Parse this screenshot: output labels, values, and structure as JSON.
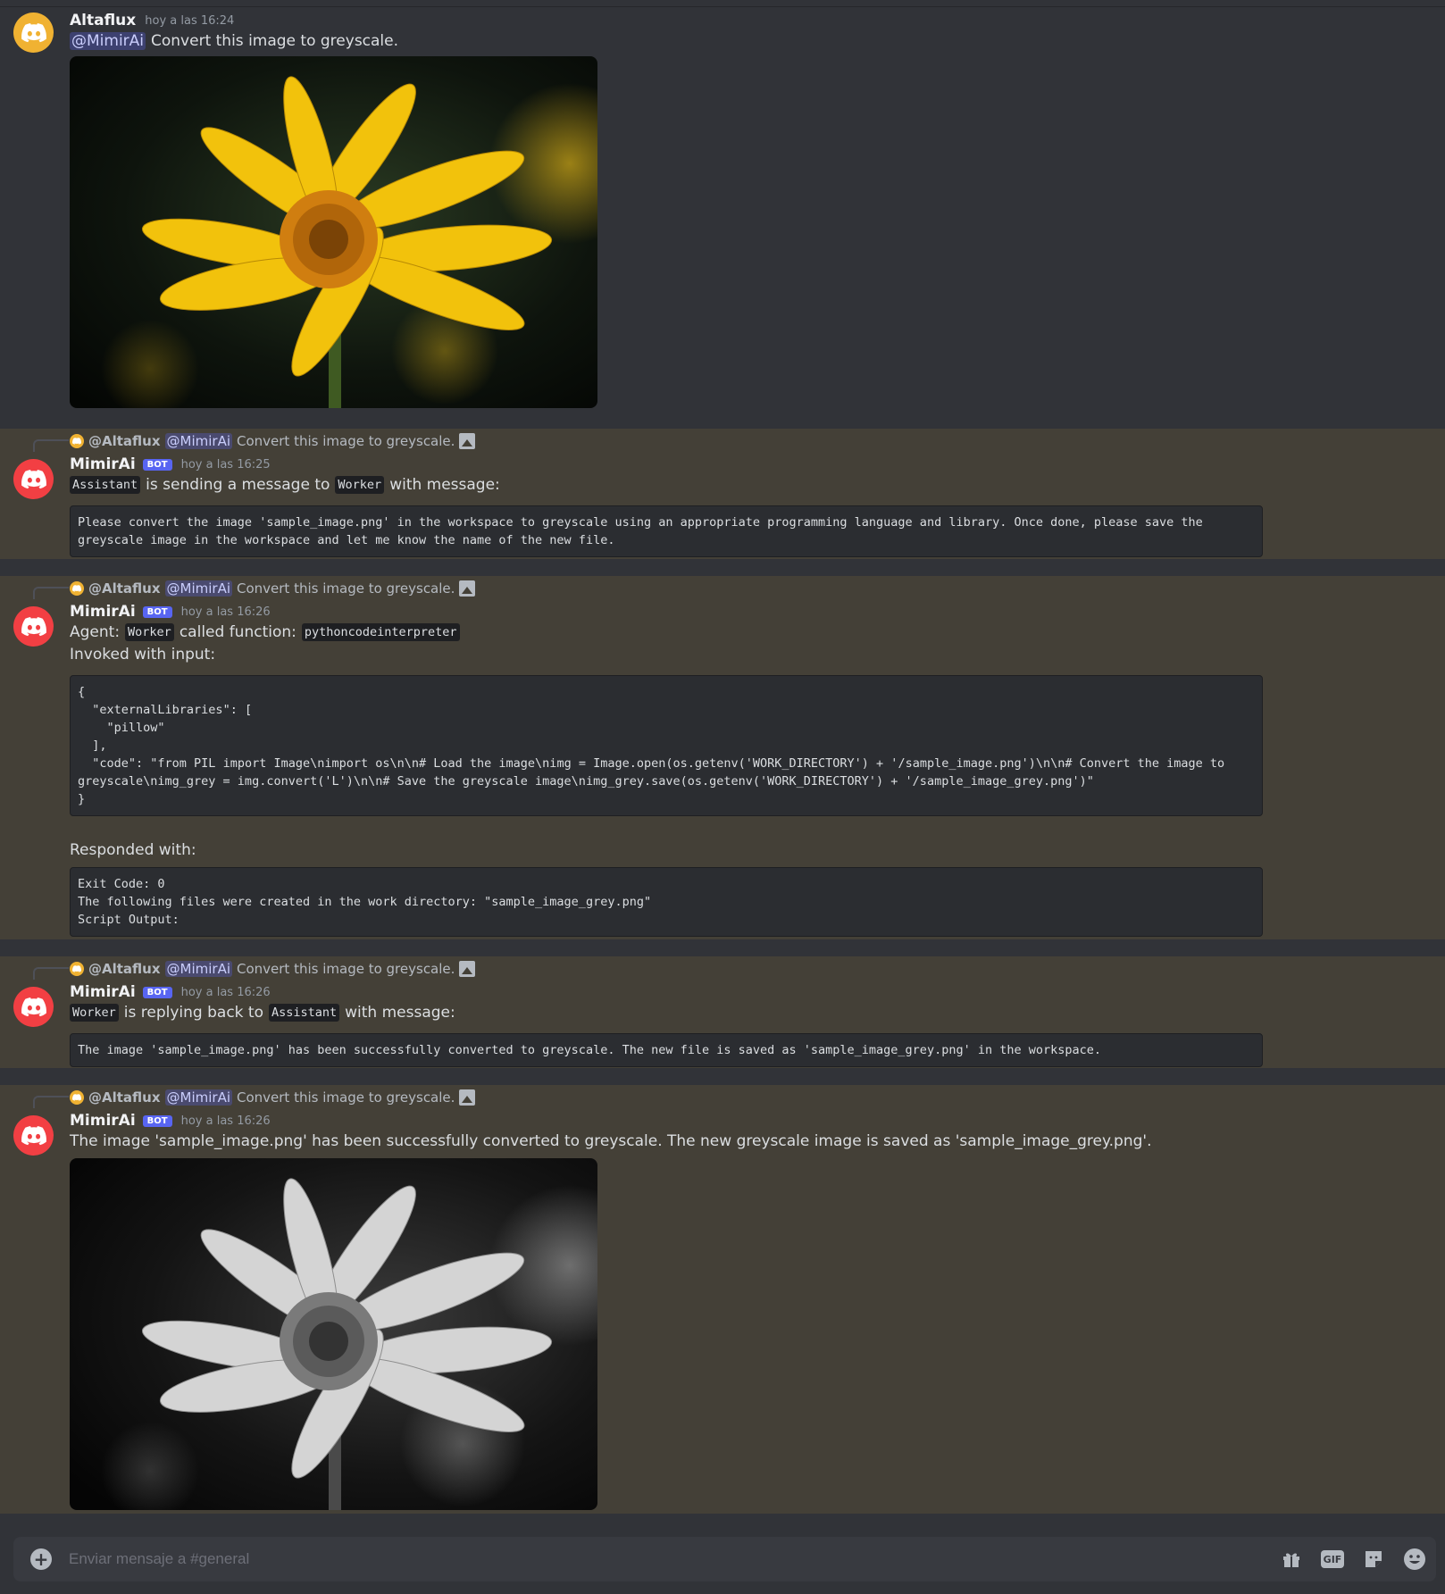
{
  "messages": {
    "m1": {
      "author": "Altaflux",
      "timestamp": "hoy a las 16:24",
      "mention": "@MimirAi",
      "text": "Convert this image to greyscale."
    },
    "reply": {
      "author": "@Altaflux",
      "mention": "@MimirAi",
      "text": "Convert this image to greyscale."
    },
    "m2": {
      "author": "MimirAi",
      "badge": "BOT",
      "timestamp": "hoy a las 16:25",
      "code_from": "Assistant",
      "mid": "is sending a message to",
      "code_to": "Worker",
      "end": "with message:",
      "block": "Please convert the image 'sample_image.png' in the workspace to greyscale using an appropriate programming language and library. Once done, please save the greyscale image in the workspace and let me know the name of the new file."
    },
    "m3": {
      "author": "MimirAi",
      "badge": "BOT",
      "timestamp": "hoy a las 16:26",
      "agent_label": "Agent:",
      "agent": "Worker",
      "called": "called function:",
      "function": "pythoncodeinterpreter",
      "invoked": "Invoked with input:",
      "input_block": "{\n  \"externalLibraries\": [\n    \"pillow\"\n  ],\n  \"code\": \"from PIL import Image\\nimport os\\n\\n# Load the image\\nimg = Image.open(os.getenv('WORK_DIRECTORY') + '/sample_image.png')\\n\\n# Convert the image to greyscale\\nimg_grey = img.convert('L')\\n\\n# Save the greyscale image\\nimg_grey.save(os.getenv('WORK_DIRECTORY') + '/sample_image_grey.png')\"\n}",
      "responded": "Responded with:",
      "output_block": "Exit Code: 0\nThe following files were created in the work directory: \"sample_image_grey.png\"\nScript Output:"
    },
    "m4": {
      "author": "MimirAi",
      "badge": "BOT",
      "timestamp": "hoy a las 16:26",
      "code_from": "Worker",
      "mid": "is replying back to",
      "code_to": "Assistant",
      "end": "with message:",
      "block": "The image 'sample_image.png' has been successfully converted to greyscale. The new file is saved as 'sample_image_grey.png' in the workspace."
    },
    "m5": {
      "author": "MimirAi",
      "badge": "BOT",
      "timestamp": "hoy a las 16:26",
      "text": "The image 'sample_image.png' has been successfully converted to greyscale. The new greyscale image is saved as 'sample_image_grey.png'."
    }
  },
  "composer": {
    "placeholder": "Enviar mensaje a #general",
    "gif_label": "GIF"
  },
  "colors": {
    "background": "#313338",
    "mention_highlight": "#444037",
    "bot_badge": "#5865f2",
    "codeblock": "#2b2d31"
  },
  "icons": [
    "discord-logo-icon",
    "image-attachment-icon",
    "add-attachment-icon",
    "gift-icon",
    "gif-icon",
    "sticker-icon",
    "emoji-icon"
  ]
}
